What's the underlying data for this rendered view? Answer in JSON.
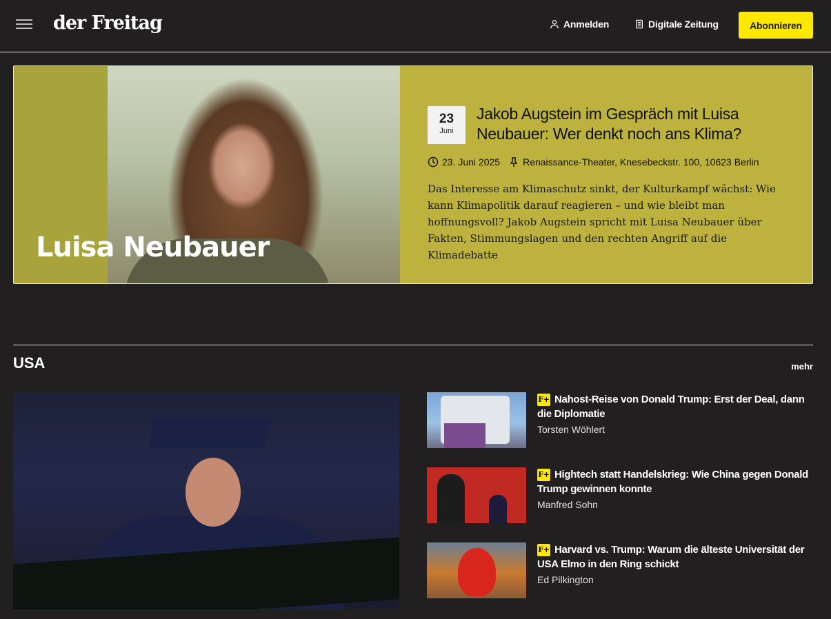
{
  "header": {
    "logo": "der Freitag",
    "login_label": "Anmelden",
    "digital_label": "Digitale Zeitung",
    "subscribe_label": "Abonnieren"
  },
  "feature": {
    "image_caption": "Luisa Neubauer",
    "date_day": "23",
    "date_month": "Juni",
    "title": "Jakob Augstein im Gespräch mit Luisa Neubauer: Wer denkt noch ans Klima?",
    "date_full": "23. Juni 2025",
    "location": "Renaissance-Theater, Knesebeckstr. 100, 10623 Berlin",
    "description": "Das Interesse am Klimaschutz sinkt, der Kulturkampf wächst: Wie kann Klimapolitik darauf reagieren – und wie bleibt man hoffnungsvoll? Jakob Augstein spricht mit Luisa Neubauer über Fakten, Stimmungslagen und den rechten Angriff auf die Klimadebatte"
  },
  "section": {
    "title": "USA",
    "more_label": "mehr"
  },
  "articles": [
    {
      "badge": "F+",
      "title": "Nahost-Reise von Donald Trump: Erst der Deal, dann die Diplomatie",
      "author": "Torsten Wöhlert"
    },
    {
      "badge": "F+",
      "title": "Hightech statt Handelskrieg: Wie China gegen Donald Trump gewinnen konnte",
      "author": "Manfred Sohn"
    },
    {
      "badge": "F+",
      "title": "Harvard vs. Trump: Warum die älteste Universität der USA Elmo in den Ring schickt",
      "author": "Ed Pilkington"
    }
  ],
  "colors": {
    "background": "#221f20",
    "accent_yellow": "#ffe800",
    "feature_olive": "#bcb23d"
  }
}
